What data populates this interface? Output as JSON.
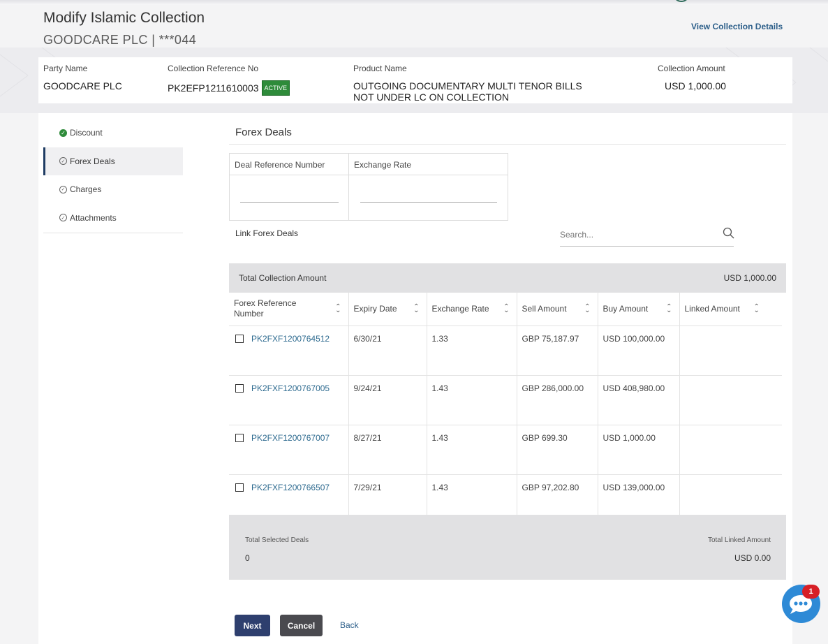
{
  "header": {
    "title": "Modify Islamic Collection",
    "subtitle": "GOODCARE PLC | ***044",
    "view_details_link": "View Collection Details"
  },
  "summary": {
    "party_name_label": "Party Name",
    "party_name_value": "GOODCARE PLC",
    "collection_ref_label": "Collection Reference No",
    "collection_ref_value": "PK2EFP1211610003",
    "status_badge": "ACTIVE",
    "product_name_label": "Product Name",
    "product_name_value": "OUTGOING DOCUMENTARY MULTI TENOR BILLS NOT UNDER LC ON COLLECTION",
    "collection_amount_label": "Collection Amount",
    "collection_amount_value": "USD 1,000.00"
  },
  "sidebar": {
    "items": [
      {
        "label": "Discount",
        "state": "completed",
        "icon": "check-circle-icon"
      },
      {
        "label": "Forex Deals",
        "state": "active",
        "icon": "check-circle-outline-icon"
      },
      {
        "label": "Charges",
        "state": "pending",
        "icon": "check-circle-outline-icon"
      },
      {
        "label": "Attachments",
        "state": "pending",
        "icon": "check-circle-outline-icon"
      }
    ]
  },
  "forex": {
    "section_title": "Forex Deals",
    "deal_ref_header": "Deal Reference Number",
    "exchange_rate_header": "Exchange Rate",
    "deal_ref_value": "",
    "exchange_rate_value": "",
    "link_label": "Link Forex Deals",
    "search_placeholder": "Search...",
    "total_label": "Total Collection Amount",
    "total_value": "USD 1,000.00",
    "columns": [
      "Forex Reference Number",
      "Expiry Date",
      "Exchange Rate",
      "Sell Amount",
      "Buy Amount",
      "Linked Amount"
    ],
    "rows": [
      {
        "ref": "PK2FXF1200764512",
        "expiry": "6/30/21",
        "rate": "1.33",
        "sell": "GBP 75,187.97",
        "buy": "USD 100,000.00",
        "linked": ""
      },
      {
        "ref": "PK2FXF1200767005",
        "expiry": "9/24/21",
        "rate": "1.43",
        "sell": "GBP 286,000.00",
        "buy": "USD 408,980.00",
        "linked": ""
      },
      {
        "ref": "PK2FXF1200767007",
        "expiry": "8/27/21",
        "rate": "1.43",
        "sell": "GBP 699.30",
        "buy": "USD 1,000.00",
        "linked": ""
      },
      {
        "ref": "PK2FXF1200766507",
        "expiry": "7/29/21",
        "rate": "1.43",
        "sell": "GBP 97,202.80",
        "buy": "USD 139,000.00",
        "linked": ""
      }
    ],
    "total_selected_label": "Total Selected Deals",
    "total_selected_value": "0",
    "total_linked_label": "Total Linked Amount",
    "total_linked_value": "USD 0.00"
  },
  "actions": {
    "next_label": "Next",
    "cancel_label": "Cancel",
    "back_label": "Back"
  },
  "chat": {
    "badge_count": "1"
  },
  "colors": {
    "primary": "#2e3f6e",
    "link": "#2d5f8a",
    "success": "#2e8b3a",
    "chat": "#2e8ad6",
    "badge": "#d71f26"
  }
}
